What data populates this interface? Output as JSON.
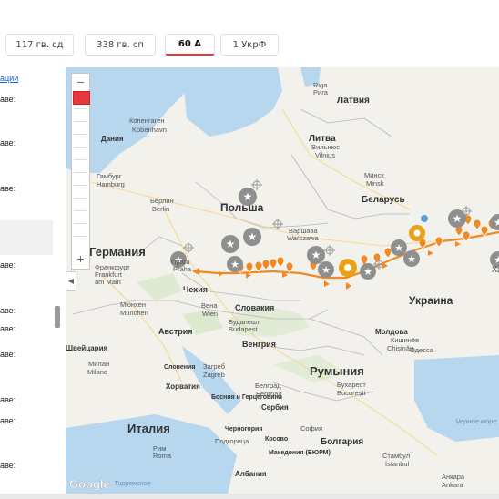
{
  "tabs": [
    {
      "label": "117 гв. сд",
      "active": false
    },
    {
      "label": "338 гв. сп",
      "active": false
    },
    {
      "label": "60 А",
      "active": true
    },
    {
      "label": "1 УкрФ",
      "active": false
    }
  ],
  "sidebar": {
    "link": "ации",
    "labels": [
      "аве:",
      "аве:",
      "аве:",
      "аве:",
      "аве:",
      "аве:",
      "аве:",
      "аве:",
      "аве:",
      "аве:"
    ]
  },
  "map": {
    "zoom_in": "+",
    "zoom_out": "−",
    "collapse": "◀",
    "attribution": "Google",
    "countries": [
      "Германия",
      "Польша",
      "Беларусь",
      "Литва",
      "Латвия",
      "Украина",
      "Чехия",
      "Словакия",
      "Австрия",
      "Венгрия",
      "Румыния",
      "Италия",
      "Хорватия",
      "Болгария",
      "Молдова",
      "Сербия",
      "Босния и Герцеговина",
      "Словения",
      "Черногория",
      "Косово",
      "Македония (БЮРМ)",
      "Албания",
      "Дания",
      "Швейцария"
    ],
    "cities": [
      "Riga",
      "Рига",
      "Копенгаген",
      "Kobenhavn",
      "Вильнюс",
      "Vilnius",
      "Минск",
      "Minsk",
      "Гамбург",
      "Hamburg",
      "Берлин",
      "Berlin",
      "Варшава",
      "Warszawa",
      "Франкфурт",
      "Frankfurt",
      "am Main",
      "Прага",
      "Praha",
      "Мюнхен",
      "München",
      "Вена",
      "Wien",
      "Будапешт",
      "Budapest",
      "Кишинёв",
      "Chișinău",
      "Одесса",
      "Бухарест",
      "București",
      "Загреб",
      "Zagreb",
      "Белград",
      "Београд",
      "Милан",
      "Milano",
      "Рим",
      "Roma",
      "Подгорица",
      "София",
      "Стамбул",
      "İstanbul",
      "Анкара",
      "Ankara",
      "Тирренское",
      "Черное море",
      "Ха"
    ],
    "colors": {
      "route": "#f08a24",
      "marker": "#f08a24",
      "grey_marker": "#8f8f8f",
      "gold_marker": "#e9a318",
      "accent": "#e8383d"
    }
  }
}
